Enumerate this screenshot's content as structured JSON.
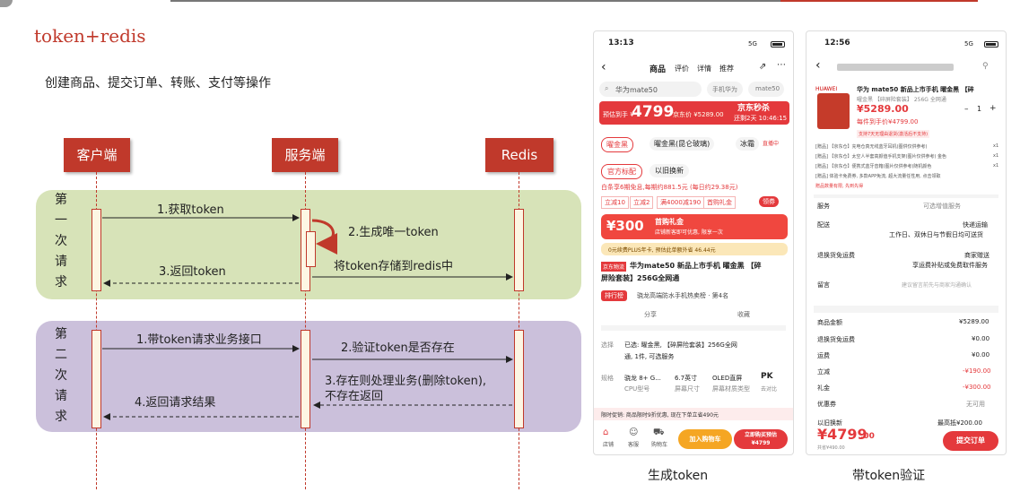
{
  "slide": {
    "title": "token+redis",
    "subtitle": "创建商品、提交订单、转账、支付等操作"
  },
  "diagram": {
    "actors": [
      "客户端",
      "服务端",
      "Redis"
    ],
    "lanes": [
      {
        "label": [
          "第",
          "一",
          "次",
          "请",
          "求"
        ]
      },
      {
        "label": [
          "第",
          "二",
          "次",
          "请",
          "求"
        ]
      }
    ],
    "messages": {
      "m1": "1.获取token",
      "m2": "2.生成唯一token",
      "m3": "将token存储到redis中",
      "m4": "3.返回token",
      "m5": "1.带token请求业务接口",
      "m6": "2.验证token是否存在",
      "m7a": "3.存在则处理业务(删除token),",
      "m7b": "不存在返回",
      "m8": "4.返回请求结果"
    }
  },
  "phone1": {
    "time": "13:13",
    "signal": "5G",
    "tabs": [
      "商品",
      "评价",
      "详情",
      "推荐"
    ],
    "search_text": "华为mate50",
    "search_chips": [
      "手机华为",
      "mate50"
    ],
    "price_label": "预估到手 ¥",
    "price": "4799",
    "jd_price": "京东价 ¥5289.00",
    "seckill": "京东秒杀",
    "countdown": "还剩2天 10:46:15",
    "colors": [
      "曜金黑",
      "曜金黑(昆仑玻璃)",
      "冰霜"
    ],
    "live": "直播中",
    "official": "官方标配",
    "trade_in": "以旧换新",
    "installment": "白条享6期免息,每期约881.5元 (每日约29.38元)",
    "coupons": [
      "立减10",
      "立减2",
      "满4000减190",
      "首购礼金"
    ],
    "receive": "领券",
    "gift_amount": "¥300",
    "gift_title": "首购礼金",
    "gift_desc": "店铺新客即可优惠, 限享一次",
    "plus": "0元续费PLUS年卡, 预估此单额外省 46.44元",
    "jd_logistics": "京东物流",
    "product_name_1": "华为mate50 新品上市手机 曜金黑 【碎",
    "product_name_2": "屏险套装】256G全网通",
    "rank_badge": "排行榜",
    "rank_text": "骁龙高端防水手机热卖榜 · 第4名",
    "share": "分享",
    "favorite": "收藏",
    "select_label": "选择",
    "select_text_1": "已选: 曜金黑, 【碎屏险套装】256G全网",
    "select_text_2": "通, 1件, 可选服务",
    "spec_label": "规格",
    "specs": [
      {
        "value": "骁龙 8+ G...",
        "name": "CPU型号"
      },
      {
        "value": "6.7英寸",
        "name": "屏幕尺寸"
      },
      {
        "value": "OLED直屏",
        "name": "屏幕材质类型"
      },
      {
        "value": "PK",
        "name": "去对比"
      }
    ],
    "promo": "限时促销: 商品限时9折优惠, 现在下单立省490元",
    "nav": [
      "店铺",
      "客服",
      "购物车"
    ],
    "add_cart": "加入购物车",
    "buy_now_1": "立即购买预估",
    "buy_now_2": "¥4799"
  },
  "phone2": {
    "time": "12:56",
    "signal": "5G",
    "brand": "HUAWEI",
    "product_title": "华为 mate50 新品上市手机 曜金黑 【碎",
    "product_sub": "曜金黑 【碎屏险套装】 256G 全网通",
    "price": "¥5289.00",
    "per_price": "每件到手价¥4799.00",
    "qty": "1",
    "service_note": "支持7天无理由退货(激活后不支持)",
    "gifts": [
      "[赠品] 【京东仓】充电仓真无线蓝牙耳机(图供仅供参考)",
      "[赠品] 【京东仓】太空人半套高颜值手机支架(图片仅供参考) 金色",
      "[赠品] 【京东仓】便携式蓝牙音箱(图片仅供参考)随机颜色",
      "[赠品] 体验卡免费券, 多款APP免流, 超大流量任性用, 点击领取"
    ],
    "gift_qty": "x1",
    "gift_note": "赠品数量有限, 先到先得",
    "service_label": "服务",
    "service_value": "可选增值服务",
    "delivery_label": "配送",
    "delivery_value_1": "快递运输",
    "delivery_value_2": "工作日、双休日与节假日均可送货",
    "return_label": "退换货免运费",
    "return_value_1": "商家赠送",
    "return_value_2": "享运费补贴或免费取件服务",
    "note_label": "留言",
    "note_placeholder": "建议留言前先与商家沟通确认",
    "summary": [
      {
        "label": "商品金额",
        "value": "¥5289.00",
        "red": false
      },
      {
        "label": "退换货免运费",
        "value": "¥0.00",
        "red": false
      },
      {
        "label": "运费",
        "value": "¥0.00",
        "red": false
      },
      {
        "label": "立减",
        "value": "-¥190.00",
        "red": true
      },
      {
        "label": "礼金",
        "value": "-¥300.00",
        "red": true
      },
      {
        "label": "优惠券",
        "value": "无可用",
        "red": false
      }
    ],
    "tradein_label": "以旧换新",
    "tradein_value": "最高抵¥200.00",
    "total": "¥4799",
    "total_dec": ".00",
    "saved": "共省¥490.00",
    "submit": "提交订单"
  },
  "captions": {
    "left": "生成token",
    "right": "带token验证"
  },
  "colors": {
    "accent": "#c0392b",
    "jd_red": "#e4393c",
    "lane1": "#d7e3b8",
    "lane2": "#cbc0db"
  }
}
